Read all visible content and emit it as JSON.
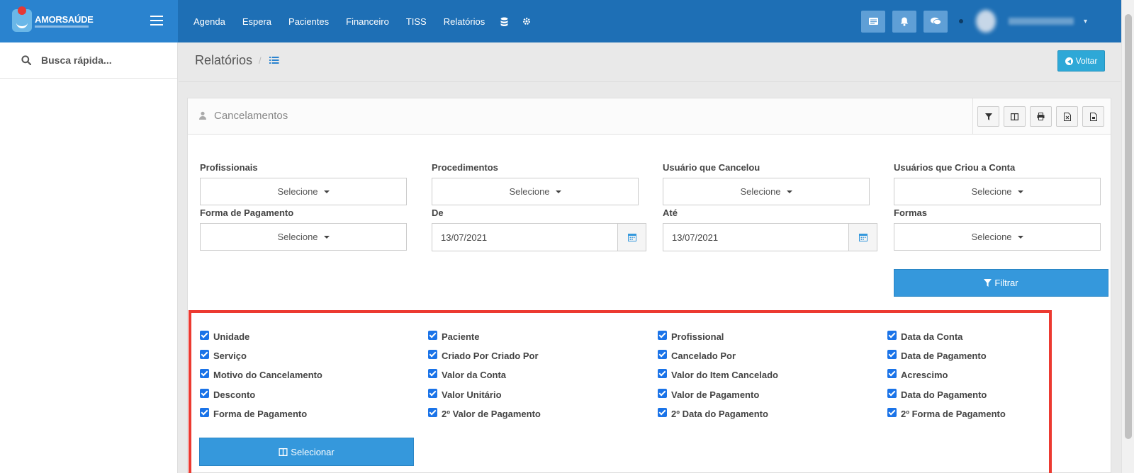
{
  "brand": {
    "name": "AMORSAÚDE"
  },
  "nav": {
    "items": [
      {
        "label": "Agenda"
      },
      {
        "label": "Espera"
      },
      {
        "label": "Pacientes"
      },
      {
        "label": "Financeiro"
      },
      {
        "label": "TISS"
      },
      {
        "label": "Relatórios"
      }
    ],
    "icons": [
      "database-icon",
      "gear-icon"
    ]
  },
  "topbar_right": {
    "icons": [
      "list-card-icon",
      "bell-icon",
      "chat-icon"
    ]
  },
  "sidebar": {
    "search_label": "Busca rápida..."
  },
  "page": {
    "title": "Relatórios",
    "separator": "/",
    "back_label": "Voltar"
  },
  "panel": {
    "title": "Cancelamentos",
    "tools": [
      "filter-icon",
      "columns-icon",
      "print-icon",
      "excel-icon",
      "pdf-icon"
    ]
  },
  "filters": {
    "profissionais": {
      "label": "Profissionais",
      "value": "Selecione"
    },
    "procedimentos": {
      "label": "Procedimentos",
      "value": "Selecione"
    },
    "usuario_cancelou": {
      "label": "Usuário que Cancelou",
      "value": "Selecione"
    },
    "usuarios_criou": {
      "label": "Usuários que Criou a Conta",
      "value": "Selecione"
    },
    "forma_pagamento": {
      "label": "Forma de Pagamento",
      "value": "Selecione"
    },
    "de": {
      "label": "De",
      "value": "13/07/2021"
    },
    "ate": {
      "label": "Até",
      "value": "13/07/2021"
    },
    "formas": {
      "label": "Formas",
      "value": "Selecione"
    },
    "filter_button": "Filtrar"
  },
  "columns": {
    "col1": [
      "Unidade",
      "Serviço",
      "Motivo do Cancelamento",
      "Desconto",
      "Forma de Pagamento"
    ],
    "col2": [
      "Paciente",
      "Criado Por Criado Por",
      "Valor da Conta",
      "Valor Unitário",
      "2º Valor de Pagamento"
    ],
    "col3": [
      "Profissional",
      "Cancelado Por",
      "Valor do Item Cancelado",
      "Valor de Pagamento",
      "2º Data do Pagamento"
    ],
    "col4": [
      "Data da Conta",
      "Data de Pagamento",
      "Acrescimo",
      "Data do Pagamento",
      "2º Forma de Pagamento"
    ],
    "all_checked": true,
    "select_button": "Selecionar"
  },
  "colors": {
    "topbar": "#1e6fb5",
    "brand": "#2a83cf",
    "primary": "#3598dc",
    "info": "#2ea8d7",
    "highlight": "#ec3a31"
  }
}
